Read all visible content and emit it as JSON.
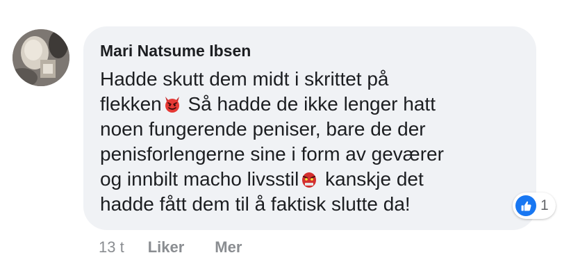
{
  "comment": {
    "author": "Mari Natsume Ibsen",
    "lines": [
      {
        "text": "Hadde skutt dem midt i skrittet på"
      },
      {
        "before": "flekken",
        "emoji": "smiling-devil-emoji",
        "after": " Så hadde de ikke lenger hatt"
      },
      {
        "text": "noen fungerende peniser, bare de der"
      },
      {
        "text": "penisforlengerne sine i form av geværer"
      },
      {
        "before": "og innbilt macho livsstil",
        "emoji": "goblin-mask-emoji",
        "after": " kanskje det"
      },
      {
        "text": "hadde fått dem til å faktisk slutte da!"
      }
    ],
    "reactions": {
      "icon": "like-icon",
      "count": "1",
      "color": "#1877f2"
    }
  },
  "actions": {
    "time": "13 t",
    "like": "Liker",
    "more": "Mer"
  },
  "colors": {
    "bubble": "#f0f2f5",
    "text": "#1c1e21",
    "muted": "#8a8d91"
  }
}
